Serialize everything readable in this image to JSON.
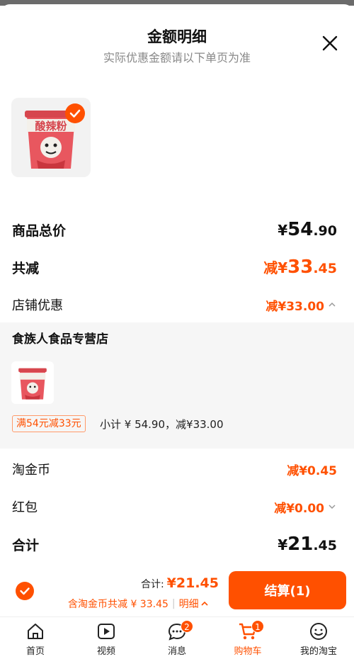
{
  "header": {
    "title": "金额明细",
    "subtitle": "实际优惠金额请以下单页为准"
  },
  "product": {
    "thumb_text": "酸辣粉",
    "selected": true
  },
  "summary": {
    "total_price": {
      "label": "商品总价",
      "currency": "¥",
      "int": "54",
      "dec": ".90"
    },
    "total_discount": {
      "label": "共减",
      "prefix": "减¥",
      "int": "33",
      "dec": ".45"
    },
    "store_discount": {
      "label": "店铺优惠",
      "value": "减¥33.00"
    }
  },
  "store": {
    "name": "食族人食品专营店",
    "promo_tag": "满54元减33元",
    "subtotal": "小计 ¥ 54.90，减¥33.00"
  },
  "extras": {
    "coins": {
      "label": "淘金币",
      "value": "减¥0.45"
    },
    "redpacket": {
      "label": "红包",
      "value": "减¥0.00"
    },
    "grand_total": {
      "label": "合计",
      "currency": "¥",
      "int": "21",
      "dec": ".45"
    }
  },
  "bottom": {
    "total_label": "合计:",
    "total_value": "¥21.45",
    "coin_note": "含淘金币共减 ¥ 33.45",
    "detail_label": "明细",
    "checkout_label": "结算(1)"
  },
  "tabs": [
    {
      "label": "首页",
      "icon": "home-icon"
    },
    {
      "label": "视频",
      "icon": "video-icon"
    },
    {
      "label": "消息",
      "icon": "message-icon",
      "badge": "2"
    },
    {
      "label": "购物车",
      "icon": "cart-icon",
      "badge": "1",
      "active": true
    },
    {
      "label": "我的淘宝",
      "icon": "profile-icon"
    }
  ],
  "colors": {
    "accent": "#ff5000",
    "muted": "#888888"
  }
}
